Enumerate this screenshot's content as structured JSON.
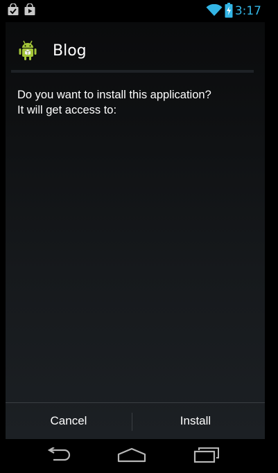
{
  "status_bar": {
    "time": "3:17",
    "left_icons": [
      "shopping-bag-icon",
      "play-store-icon"
    ],
    "right_icons": [
      "wifi-icon",
      "battery-charging-icon"
    ],
    "accent_color": "#33b5e5"
  },
  "app": {
    "name": "Blog",
    "icon": "android-app-icon",
    "icon_color": "#a4c639"
  },
  "message": {
    "line1": "Do you want to install this application?",
    "line2": "It will get access to:"
  },
  "buttons": {
    "cancel_label": "Cancel",
    "install_label": "Install"
  },
  "navigation": {
    "back": "back-icon",
    "home": "home-icon",
    "recent": "recent-apps-icon"
  }
}
